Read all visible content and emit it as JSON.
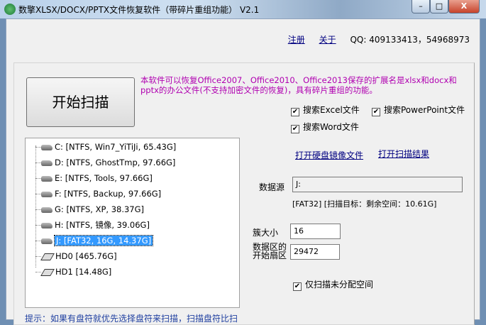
{
  "window": {
    "title": "数擎XLSX/DOCX/PPTX文件恢复软件（带碎片重组功能） V2.1",
    "minimize": "–",
    "maximize": "□",
    "close": "X"
  },
  "header": {
    "register": "注册",
    "about": "关于",
    "qq": "QQ: 409133413，54968973"
  },
  "start_button": "开始扫描",
  "description": "本软件可以恢复Office2007、Office2010、Office2013保存的扩展名是xlsx和docx和pptx的办公文件(不支持加密文件的恢复)，具有碎片重组的功能。",
  "drives": [
    {
      "label": "C:   [NTFS, Win7_YiTiJi, 65.43G]",
      "type": "volume",
      "selected": false
    },
    {
      "label": "D:   [NTFS, GhostTmp, 97.66G]",
      "type": "volume",
      "selected": false
    },
    {
      "label": "E:   [NTFS, Tools, 97.66G]",
      "type": "volume",
      "selected": false
    },
    {
      "label": "F:   [NTFS, Backup, 97.66G]",
      "type": "volume",
      "selected": false
    },
    {
      "label": "G:   [NTFS, XP, 38.37G]",
      "type": "volume",
      "selected": false
    },
    {
      "label": "H:   [NTFS, 镜像, 39.06G]",
      "type": "volume",
      "selected": false
    },
    {
      "label": "J:   [FAT32, 16G, 14.37G]",
      "type": "volume",
      "selected": true
    },
    {
      "label": "HD0   [465.76G]",
      "type": "disk",
      "selected": false
    },
    {
      "label": "HD1   [14.48G]",
      "type": "disk",
      "selected": false
    }
  ],
  "options": {
    "excel": {
      "label": "搜索Excel文件",
      "checked": true
    },
    "powerpoint": {
      "label": "搜索PowerPoint文件",
      "checked": true
    },
    "word": {
      "label": "搜索Word文件",
      "checked": true
    },
    "unallocated": {
      "label": "仅扫描未分配空间",
      "checked": true
    }
  },
  "links": {
    "open_image": "打开硬盘镜像文件",
    "open_result": "打开扫描结果"
  },
  "source": {
    "label": "数据源",
    "value": "J:",
    "info": "[FAT32]  [扫描目标：剩余空间：10.61G]"
  },
  "cluster": {
    "label": "簇大小",
    "value": "16"
  },
  "start_sector": {
    "label1": "数据区的",
    "label2": "开始扇区",
    "value": "29472"
  },
  "tip": "提示：如果有盘符就优先选择盘符来扫描，扫描盘符比扫"
}
